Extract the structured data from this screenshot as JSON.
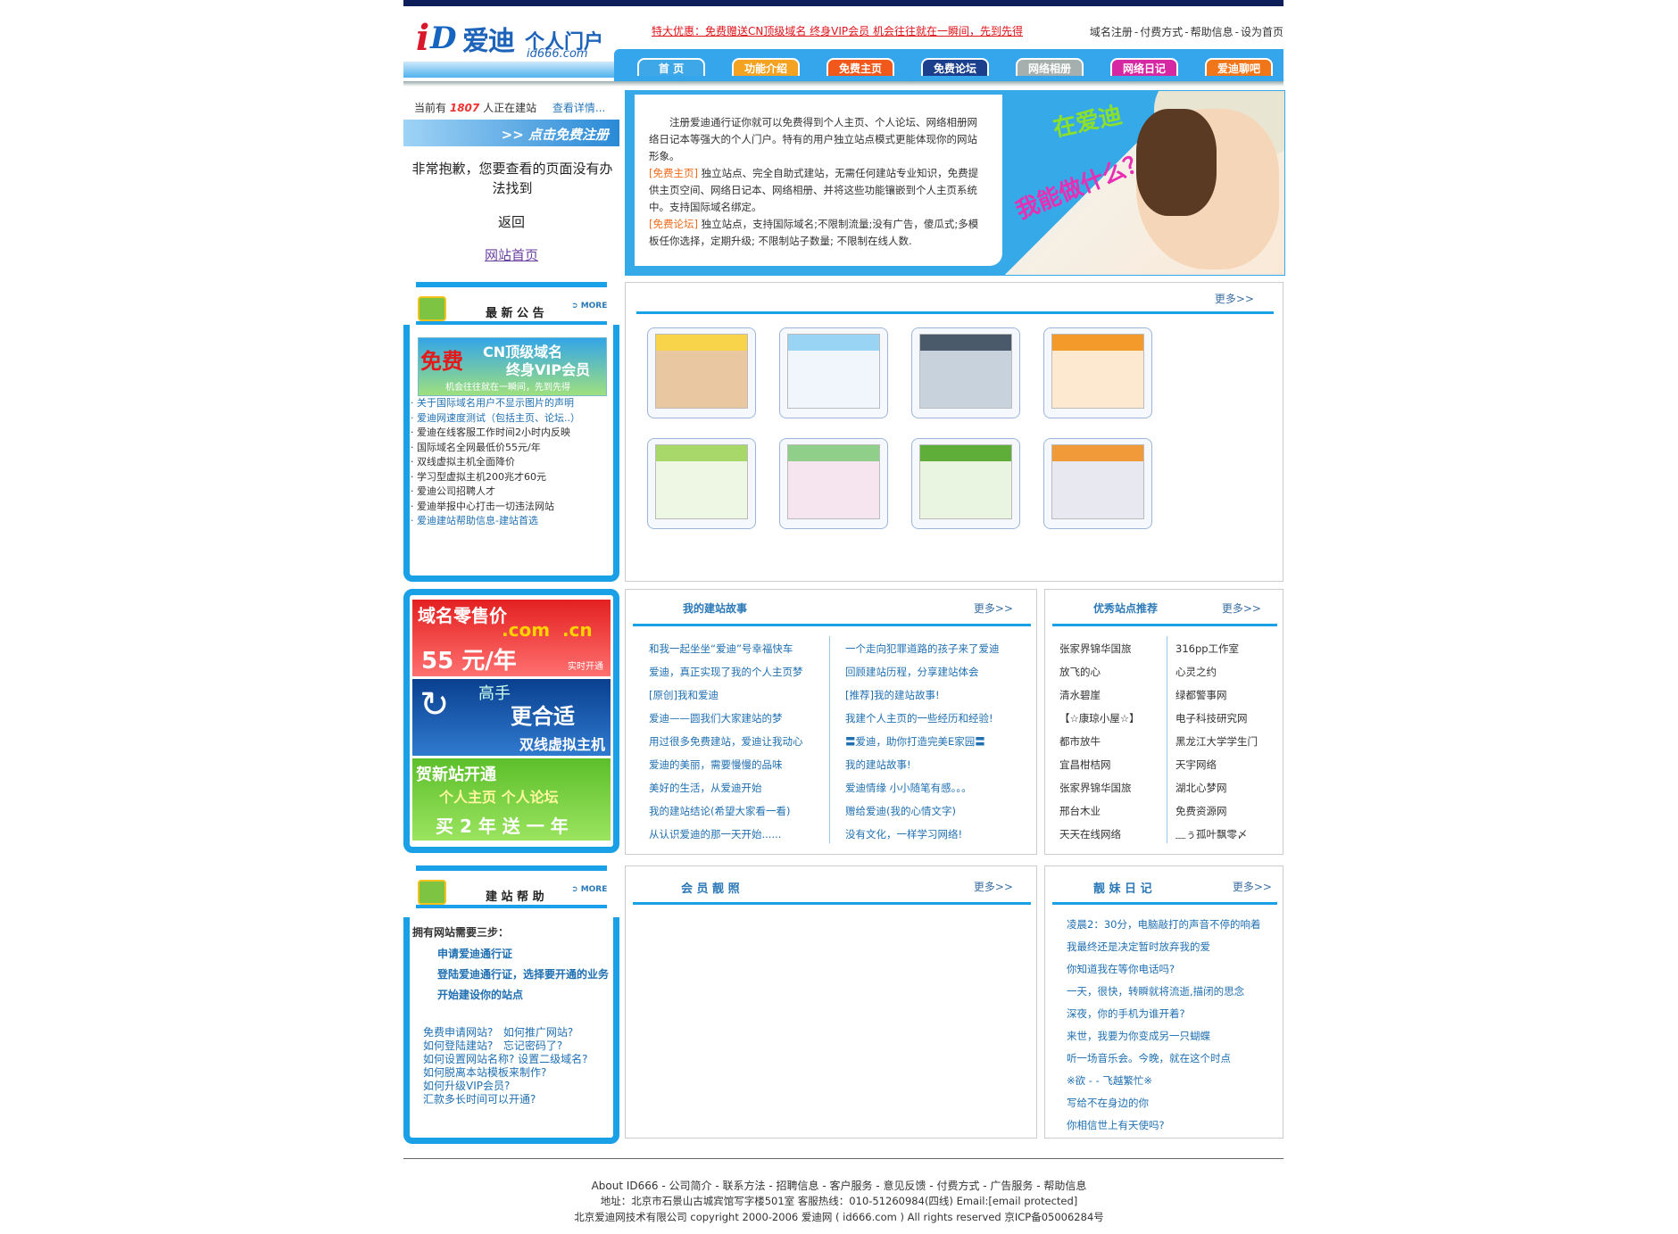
{
  "header": {
    "logo_i": "i",
    "logo_d": "D",
    "logo_cn": "爱迪",
    "logo_sub": "个人门户",
    "logo_domain": "id666.com",
    "promo": "特大优惠：免费赠送CN顶级域名 终身VIP会员 机会往往就在一瞬间，先到先得",
    "toplinks": [
      "域名注册",
      "付费方式",
      "帮助信息",
      "设为首页"
    ],
    "nav": [
      {
        "label": "首 页",
        "color": "#3ea7e8"
      },
      {
        "label": "功能介绍",
        "color": "#f3a321"
      },
      {
        "label": "免费主页",
        "color": "#f0591b"
      },
      {
        "label": "免费论坛",
        "color": "#1b3f8c"
      },
      {
        "label": "网络相册",
        "color": "#a5b0ae"
      },
      {
        "label": "网络日记",
        "color": "#d728a3"
      },
      {
        "label": "爱迪聊吧",
        "color": "#f1761a"
      }
    ]
  },
  "sidebar": {
    "online_prefix": "当前有",
    "online_count": "1807",
    "online_suffix": "人正在建站",
    "details_link": "查看详情...",
    "register_button": ">> 点击免费注册",
    "error_msg": "非常抱歉，您要查看的页面没有办法找到",
    "back_link": "返回",
    "home_link": "网站首页",
    "notice_title": "最 新 公 告",
    "more_tag": "MORE",
    "banner_free": "免费",
    "banner_line1": "CN顶级域名",
    "banner_line2": "终身VIP会员",
    "banner_line3": "机会往往就在一瞬间，先到先得",
    "notices": [
      "关于国际域名用户不显示图片的声明",
      "爱迪网速度测试（包括主页、论坛..）",
      "爱迪在线客服工作时间2小时内反映",
      "国际域名全网最低价55元/年",
      "双线虚拟主机全面降价",
      "学习型虚拟主机200兆才60元",
      "爱迪公司招聘人才",
      "爱迪举报中心打击一切违法网站",
      "爱迪建站帮助信息-建站首选"
    ],
    "ad1": {
      "l1": "域名零售价",
      "l2": ".com  .cn",
      "l3": "55 元/年",
      "l4": "实时开通"
    },
    "ad2": {
      "l1": "高手",
      "l2": "更合适",
      "l3": "双线虚拟主机"
    },
    "ad3": {
      "l1": "贺新站开通",
      "l2": "个人主页 个人论坛",
      "l3": "买 2 年 送 一 年"
    },
    "help_title": "建 站 帮 助",
    "help_intro": "拥有网站需要三步：",
    "help_steps": [
      "申请爱迪通行证",
      "登陆爱迪通行证，选择要开通的业务",
      "开始建设你的站点"
    ],
    "help_faq": [
      "免费申请网站?   如何推广网站?",
      "如何登陆建站?   忘记密码了?",
      "如何设置网站名称? 设置二级域名?",
      "如何脱离本站模板来制作?",
      "如何升级VIP会员?",
      "汇款多长时间可以开通?"
    ]
  },
  "intro": {
    "p1": "注册爱迪通行证你就可以免费得到个人主页、个人论坛、网络相册网络日记本等强大的个人门户。特有的用户独立站点模式更能体现你的网站形象。",
    "tag1": "[免费主页]",
    "p2": " 独立站点、完全自助式建站，无需任何建站专业知识，免费提供主页空间、网络日记本、网络相册、并将这些功能镶嵌到个人主页系统中。支持国际域名绑定。",
    "tag2": "[免费论坛]",
    "p3": " 独立站点，支持国际域名;不限制流量;没有广告，傻瓜式;多模板任你选择，定期升级; 不限制站子数量; 不限制在线人数.",
    "hero1": "在爱迪",
    "hero2": "我能做什么？"
  },
  "gallery": {
    "more": "更多>>"
  },
  "stories": {
    "title": "我的建站故事",
    "more": "更多>>",
    "col1": [
      "和我一起坐坐“爱迪”号幸福快车",
      "爱迪，真正实现了我的个人主页梦",
      "[原创]我和爱迪",
      "爱迪——圆我们大家建站的梦",
      "用过很多免费建站，爱迪让我动心",
      "爱迪的美丽，需要慢慢的品味",
      "美好的生活，从爱迪开始",
      "我的建站结论(希望大家看一看)",
      "从认识爱迪的那一天开始......"
    ],
    "col2": [
      "一个走向犯罪道路的孩子来了爱迪",
      "回顾建站历程，分享建站体会",
      "[推荐]我的建站故事!",
      "我建个人主页的一些经历和经验!",
      "〓爱迪，助你打造完美E家园〓",
      "我的建站故事!",
      "爱迪情缘 小小随笔有感。。。",
      "赠给爱迪(我的心情文字)",
      "没有文化，一样学习网络!"
    ]
  },
  "recommend": {
    "title": "优秀站点推荐",
    "more": "更多>>",
    "col1": [
      "张家界锦华国旅",
      "放飞的心",
      "清水碧崖",
      "【☆康琼小屋☆】",
      "都市放牛",
      "宜昌柑桔网",
      "张家界锦华国旅",
      "邢台木业",
      "天天在线网络"
    ],
    "col2": [
      "316pp工作室",
      "心灵之约",
      "绿都警事网",
      "电子科技研究网",
      "黑龙江大学学生门",
      "天宇网络",
      "湖北心梦网",
      "免费资源网",
      "﹏ぅ孤叶飘零〆"
    ]
  },
  "photos": {
    "title": "会 员 靓 照",
    "more": "更多>>"
  },
  "diary": {
    "title": "靓 妹 日 记",
    "more": "更多>>",
    "items": [
      "凌晨2：30分，电脑敲打的声音不停的响着",
      "我最终还是决定暂时放弃我的爱",
      "你知道我在等你电话吗?",
      "一天，很快，转瞬就将流逝,描闭的思念",
      "深夜，你的手机为谁开着?",
      "来世，我要为你变成另一只蝴蝶",
      "听一场音乐会。今晚，就在这个时点",
      "※欲 - - 飞越繁忙※",
      "写给不在身边的你",
      "你相信世上有天使吗?"
    ]
  },
  "footer": {
    "links": [
      "About ID666",
      "公司简介",
      "联系方法",
      "招聘信息",
      "客户服务",
      "意见反馈",
      "付费方式",
      "广告服务",
      "帮助信息"
    ],
    "address": "地址：北京市石景山古城宾馆写字楼501室 客服热线：010-51260984(四线)    Email:[email protected]",
    "copyright": "北京爱迪网技术有限公司 copyright 2000-2006 爱迪网 ( id666.com ) All rights reserved   京ICP备05006284号"
  }
}
